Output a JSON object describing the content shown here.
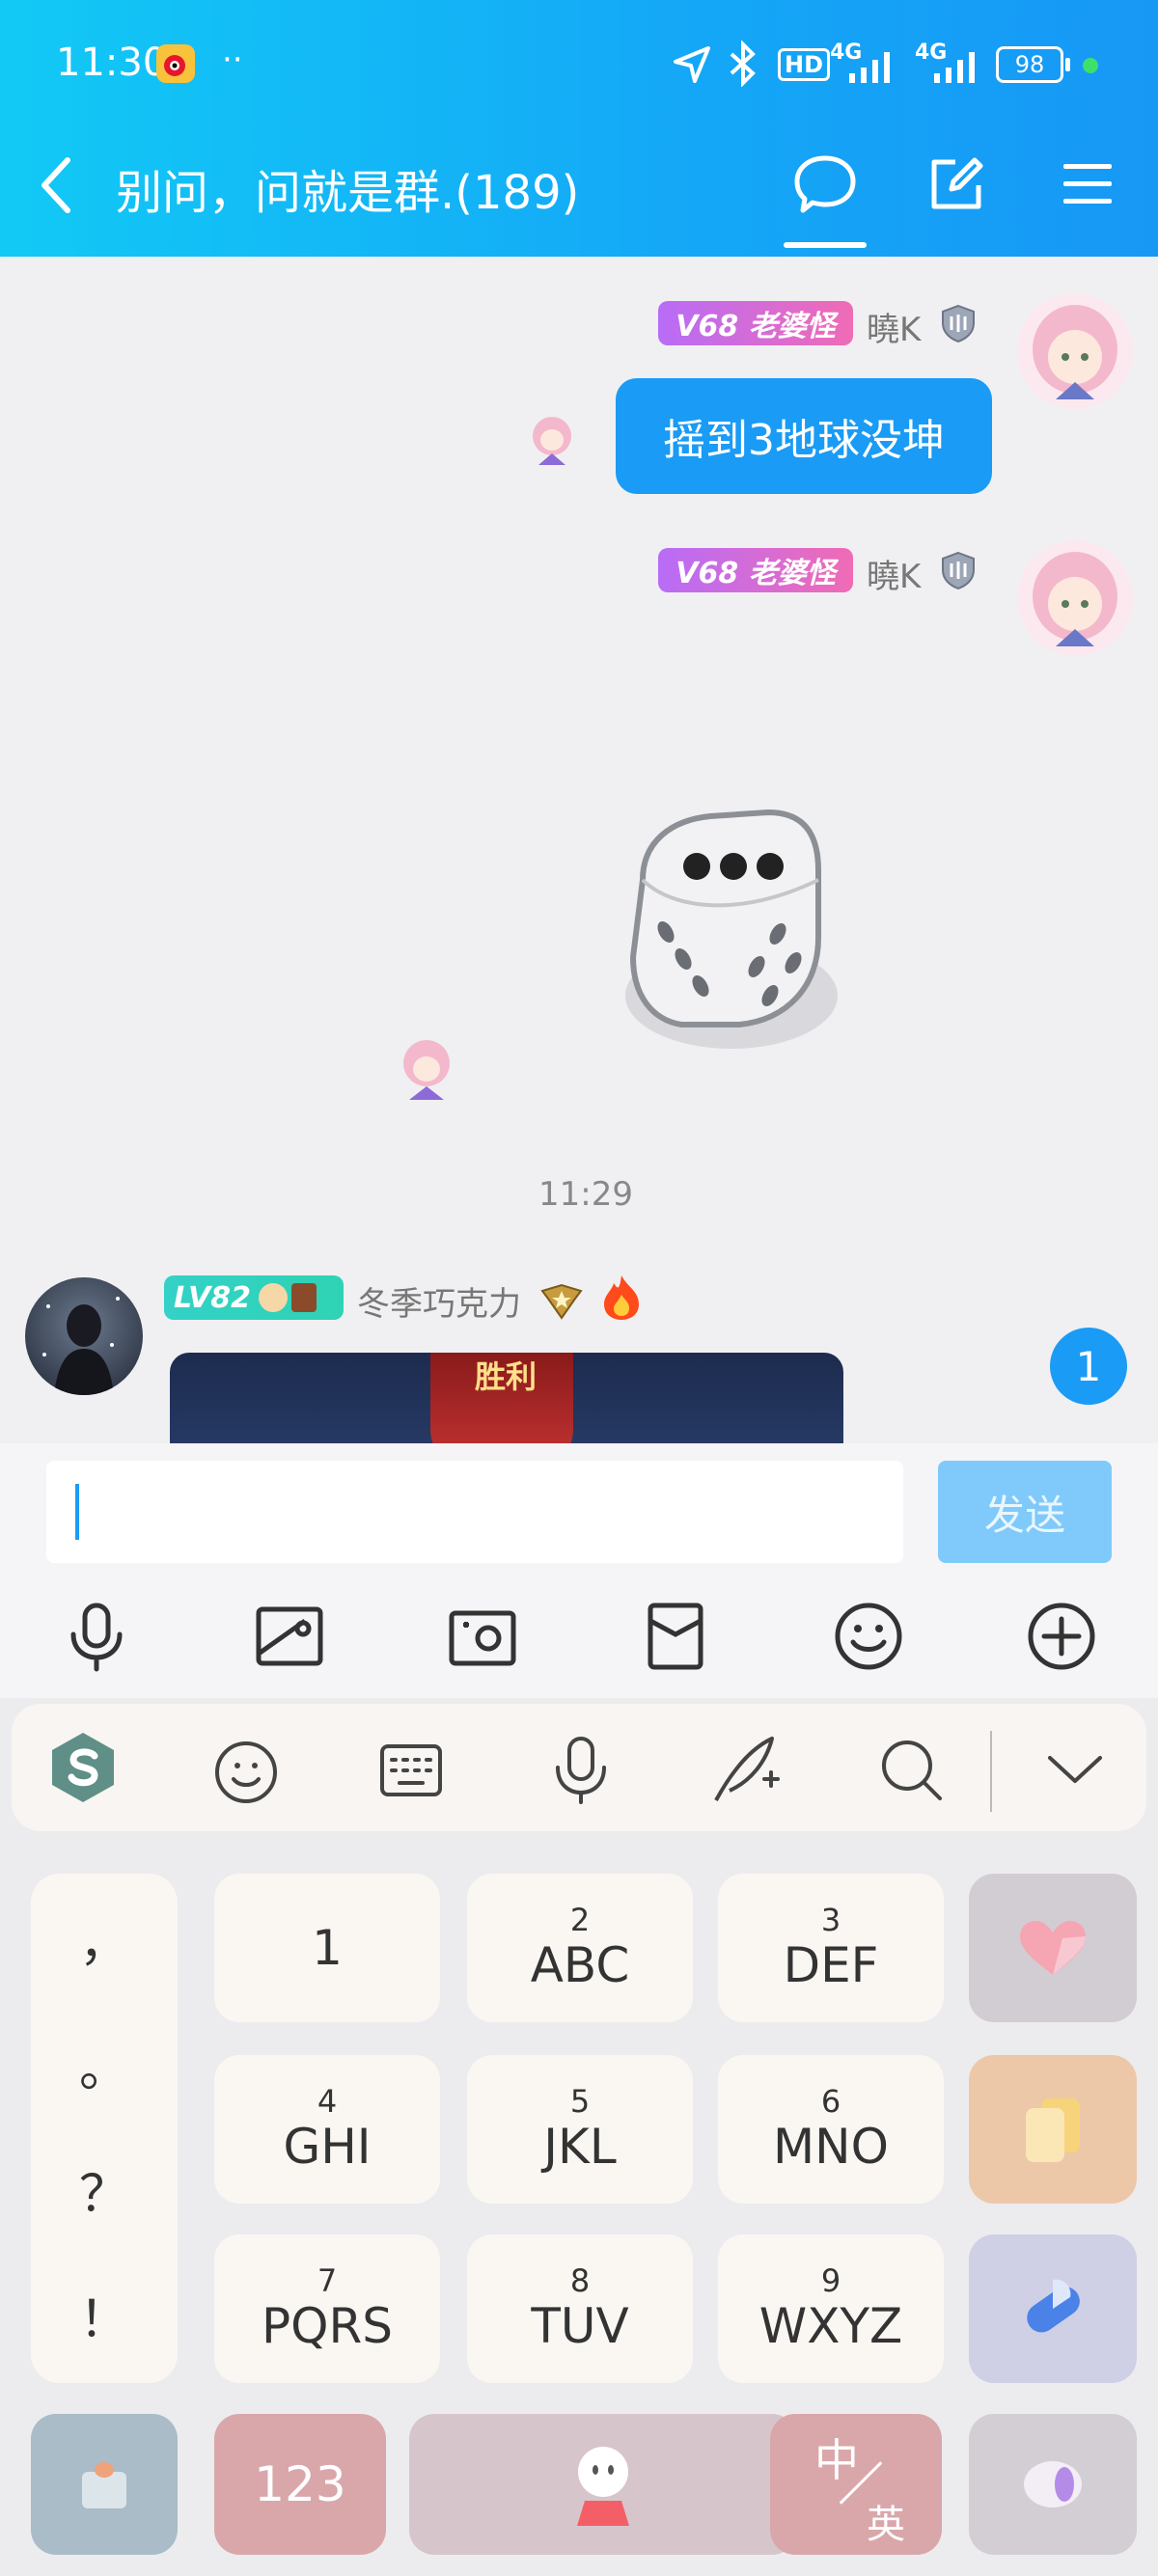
{
  "status_bar": {
    "time": "11:30",
    "network_label_1": "4G",
    "network_label_2": "4G",
    "hd_label": "HD",
    "battery": "98"
  },
  "header": {
    "title": "别问，问就是群.(189)"
  },
  "messages": [
    {
      "badge": "V68 老婆怪",
      "nickname": "曉K",
      "text": "摇到3地球没坤"
    },
    {
      "badge": "V68 老婆怪",
      "nickname": "曉K",
      "sticker": "dice-icon"
    }
  ],
  "timestamp": "11:29",
  "incoming": {
    "badge": "LV82",
    "nickname": "冬季巧克力",
    "image_caption": "胜利"
  },
  "unread_count": "1",
  "input": {
    "placeholder": "",
    "send_label": "发送"
  },
  "keyboard": {
    "keys": [
      {
        "num": "",
        "letters": "1"
      },
      {
        "num": "2",
        "letters": "ABC"
      },
      {
        "num": "3",
        "letters": "DEF"
      },
      {
        "num": "4",
        "letters": "GHI"
      },
      {
        "num": "5",
        "letters": "JKL"
      },
      {
        "num": "6",
        "letters": "MNO"
      },
      {
        "num": "7",
        "letters": "PQRS"
      },
      {
        "num": "8",
        "letters": "TUV"
      },
      {
        "num": "9",
        "letters": "WXYZ"
      }
    ],
    "punctuation": [
      "，",
      "。",
      "？",
      "！"
    ],
    "numbers_key": "123",
    "lang_key_top": "中",
    "lang_key_bottom": "英"
  },
  "colors": {
    "accent": "#1a9bf5",
    "header_start": "#12c9f5",
    "header_end": "#1798f5",
    "send_disabled": "#7fcafa"
  }
}
